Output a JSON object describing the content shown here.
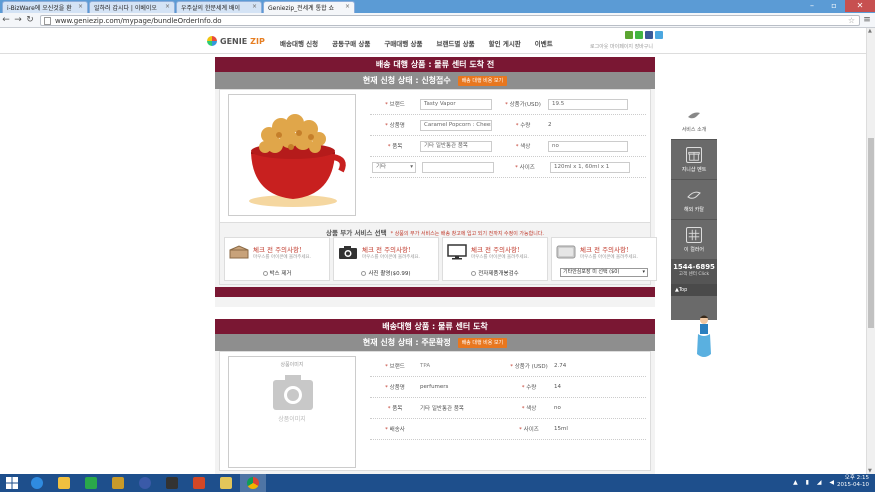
{
  "browser": {
    "tabs": [
      {
        "label": "i-BizWare에 오신것을 환"
      },
      {
        "label": "일하러 갑시다 | 이베이오"
      },
      {
        "label": "우주살의 한문세계 배이"
      },
      {
        "label": "Geniezip_전세계 통합 쇼"
      }
    ],
    "url": "www.geniezip.com/mypage/bundleOrderInfo.do"
  },
  "site": {
    "logo_text_1": "GENIE",
    "logo_text_2": "ZIP",
    "nav": [
      "배송대행 신청",
      "공동구매 상품",
      "구매대행 상품",
      "브랜드별 상품",
      "할인 게시판",
      "이벤트"
    ],
    "tagline": "로그아웃 마이페이지 장바구니"
  },
  "order1": {
    "title": "배송 대행 상품 : 물류 센터 도착 전",
    "status": "현재 신청 상태 : 신청접수",
    "status_btn": "배송 대행 비용 보기",
    "fields": {
      "brand_label": "브랜드",
      "brand_value": "Tasty Vapor",
      "price_label": "상품가(USD)",
      "price_value": "19.5",
      "name_label": "상품명",
      "name_value": "Caramel Popcorn : Cheesec",
      "qty_label": "수량",
      "qty_value": "2",
      "category_label": "품목",
      "category_value": "기타 일반통관 품목",
      "color_label": "색상",
      "color_value": "no",
      "other_select": "기타",
      "size_label": "사이즈",
      "size_value": "120ml x 1, 60ml x 1"
    },
    "addon": {
      "title": "상품 부가 서비스 선택",
      "note": "* 상품의 부가 서비스는 배송 창고에 입고 되기 전까지 수정이 가능합니다.",
      "cards": [
        {
          "title": "체크 전 주의사항!",
          "sub": "마우스를 아이콘에 올려주세요.",
          "option": "박스 제거"
        },
        {
          "title": "체크 전 주의사항!",
          "sub": "마우스를 아이콘에 올려주세요.",
          "option": "사진 촬영($0.99)"
        },
        {
          "title": "체크 전 주의사항!",
          "sub": "마우스를 아이콘에 올려주세요.",
          "option": "전자제품개봉검수"
        },
        {
          "title": "체크 전 주의사항!",
          "sub": "마우스를 아이콘에 올려주세요.",
          "option": "기타안심포장 미 선택 ($0)"
        }
      ]
    }
  },
  "order2": {
    "title": "배송대행 상품 : 물류 센터 도착",
    "status": "현재 신청 상태 : 주문확정",
    "status_btn": "배송 대행 비용 보기",
    "image_caption_top": "상품이미지",
    "image_caption_bottom": "상품이미지",
    "fields": {
      "brand_label": "브랜드",
      "brand_value": "TPA",
      "price_label": "상품가 (USD)",
      "price_value": "2.74",
      "name_label": "상품명",
      "name_value": "perfumers",
      "qty_label": "수량",
      "qty_value": "14",
      "category_label": "품목",
      "category_value": "기타 일반통관 품목",
      "color_label": "색상",
      "color_value": "no",
      "company_label": "배송사",
      "size_label": "사이즈",
      "size_value": "15ml"
    }
  },
  "sidebar": {
    "items": [
      "서비스 소개",
      "지니샵 벤트",
      "해외 카탈",
      "이 컬러어"
    ],
    "phone": "1544-6895",
    "phone_sub": "고객 센터 Click",
    "top": "▲Top"
  },
  "taskbar": {
    "time": "오후 2:15",
    "date": "2015-04-10"
  },
  "colors": {
    "maroon": "#7a1733",
    "status_gray": "#8e8e8e",
    "orange": "#e8771f",
    "taskbar": "#1e4f8c"
  }
}
